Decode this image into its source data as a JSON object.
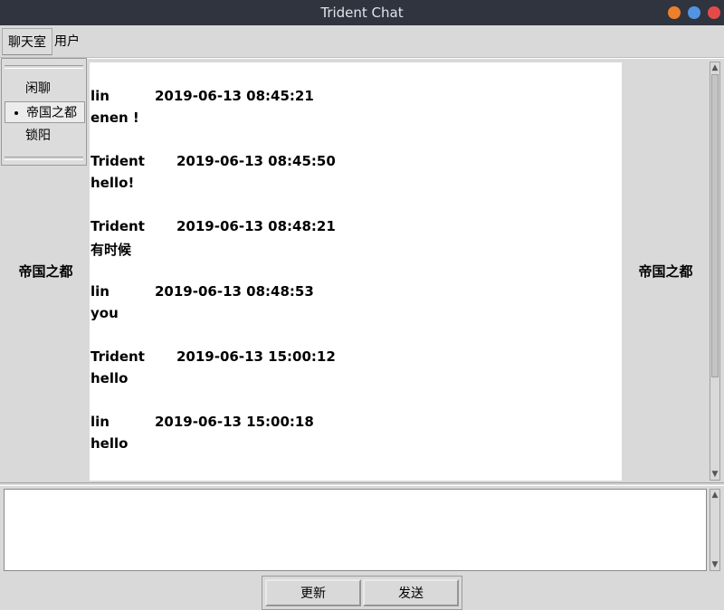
{
  "window": {
    "title": "Trident Chat",
    "buttons": [
      {
        "name": "minimize",
        "color": "#ee7f2d"
      },
      {
        "name": "maximize",
        "color": "#5294e2"
      },
      {
        "name": "close",
        "color": "#e54a4a"
      }
    ]
  },
  "menubar": {
    "items": [
      "聊天室",
      "用户"
    ]
  },
  "room_menu": {
    "items": [
      "闲聊",
      "帝国之都",
      "锁阳"
    ],
    "selected": "帝国之都"
  },
  "left_panel": {
    "label": "帝国之都"
  },
  "right_panel": {
    "label": "帝国之都"
  },
  "messages": [
    {
      "sender": "lin",
      "time": "2019-06-13 08:45:21",
      "text": "enen !"
    },
    {
      "sender": "Trident",
      "time": "2019-06-13 08:45:50",
      "text": "hello!"
    },
    {
      "sender": "Trident",
      "time": "2019-06-13 08:48:21",
      "text": "有时候"
    },
    {
      "sender": "lin",
      "time": "2019-06-13 08:48:53",
      "text": "you"
    },
    {
      "sender": "Trident",
      "time": "2019-06-13 15:00:12",
      "text": "hello"
    },
    {
      "sender": "lin",
      "time": "2019-06-13 15:00:18",
      "text": "hello"
    }
  ],
  "compose": {
    "value": ""
  },
  "buttons": {
    "refresh": "更新",
    "send": "发送"
  },
  "icons": {
    "arrow_up": "▲",
    "arrow_down": "▼"
  }
}
